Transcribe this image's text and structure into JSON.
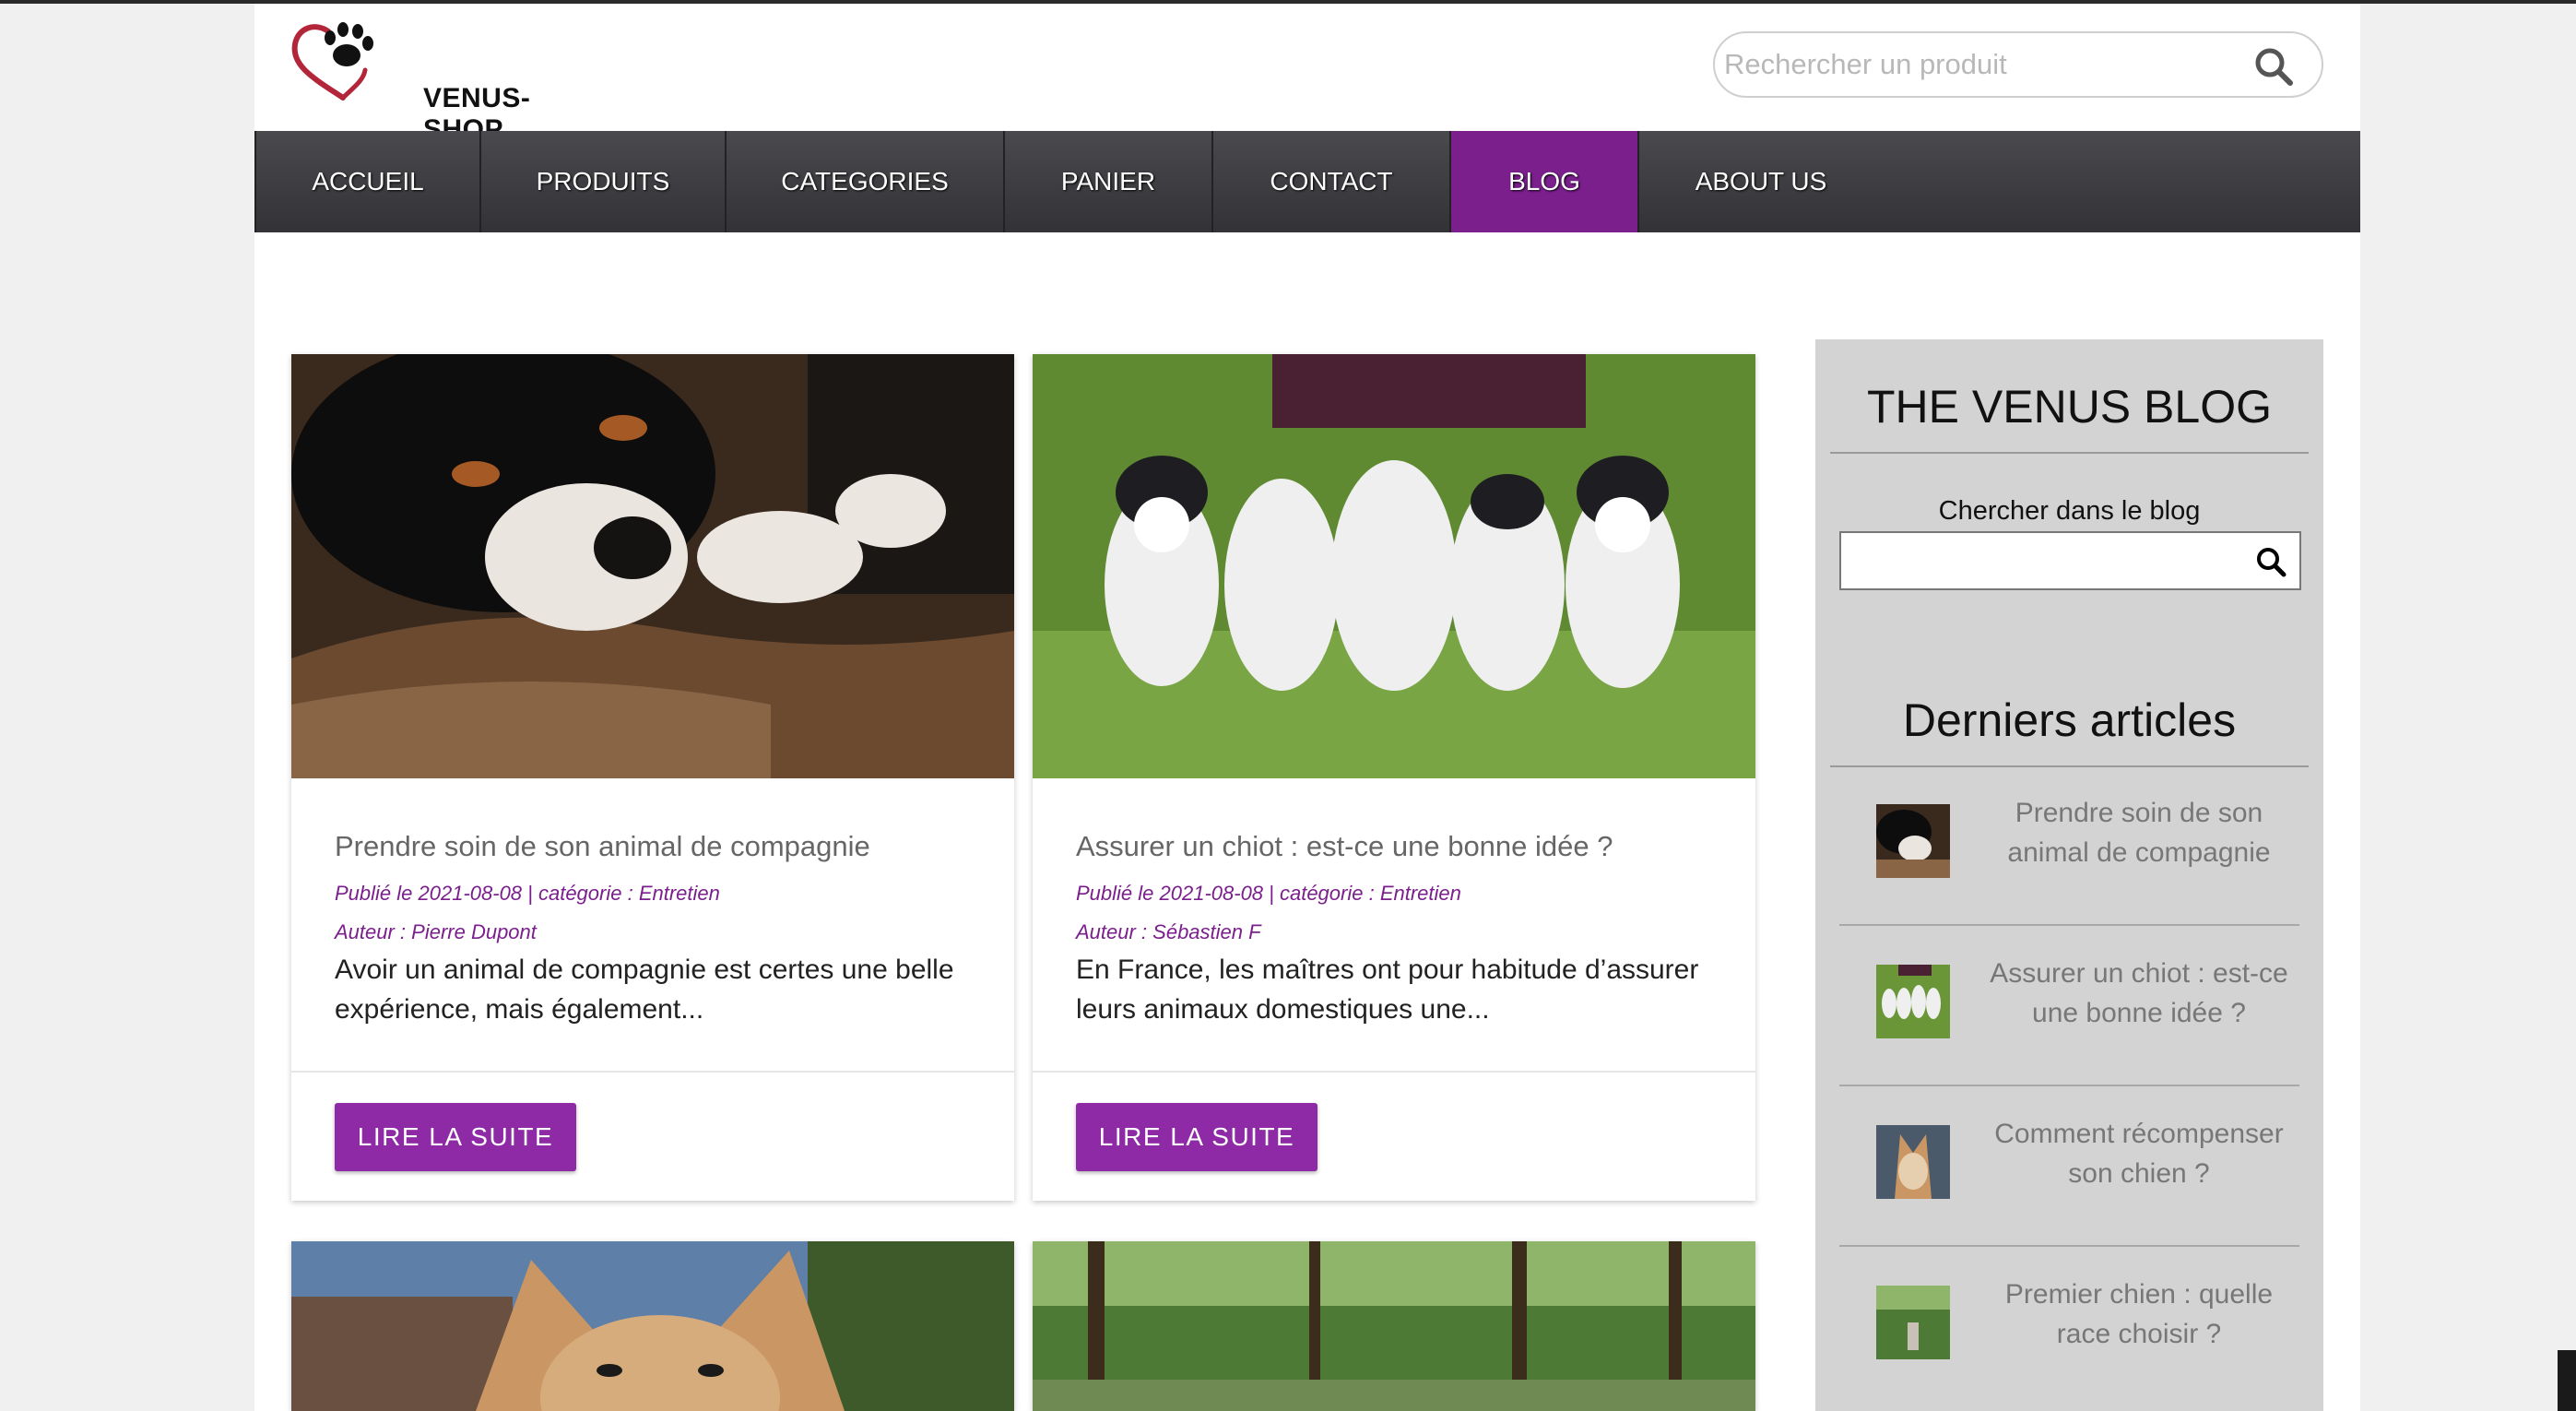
{
  "brand": {
    "name": "VENUS-SHOP"
  },
  "header": {
    "search_placeholder": "Rechercher un produit",
    "search_icon": "search-icon"
  },
  "nav": {
    "items": [
      {
        "label": "ACCUEIL"
      },
      {
        "label": "PRODUITS"
      },
      {
        "label": "CATEGORIES"
      },
      {
        "label": "PANIER"
      },
      {
        "label": "CONTACT"
      },
      {
        "label": "BLOG",
        "active": true
      },
      {
        "label": "ABOUT US"
      }
    ]
  },
  "colors": {
    "accent": "#7a1f8c",
    "button": "#8e2aa5",
    "nav_bg": "#3d3d41",
    "sidebar_bg": "#d3d3d3"
  },
  "posts": [
    {
      "title": "Prendre soin de son animal de compagnie",
      "meta": "Publié le 2021-08-08 | catégorie : Entretien",
      "author": "Auteur : Pierre Dupont",
      "excerpt": "Avoir un animal de compagnie est certes une belle expérience, mais également...",
      "button": "LIRE LA SUITE"
    },
    {
      "title": "Assurer un chiot : est-ce une bonne idée ?",
      "meta": "Publié le 2021-08-08 | catégorie : Entretien",
      "author": "Auteur : Sébastien F",
      "excerpt": "En France, les maîtres ont pour habitude d’assurer leurs animaux domestiques une...",
      "button": "LIRE LA SUITE"
    }
  ],
  "sidebar": {
    "blog_title": "THE VENUS BLOG",
    "search_label": "Chercher dans le blog",
    "search_value": "",
    "recent_title": "Derniers articles",
    "recent": [
      {
        "title": "Prendre soin de son animal de compagnie"
      },
      {
        "title": "Assurer un chiot : est-ce une bonne idée ?"
      },
      {
        "title": "Comment récompenser son chien ?"
      },
      {
        "title": "Premier chien : quelle race choisir ?"
      }
    ]
  }
}
